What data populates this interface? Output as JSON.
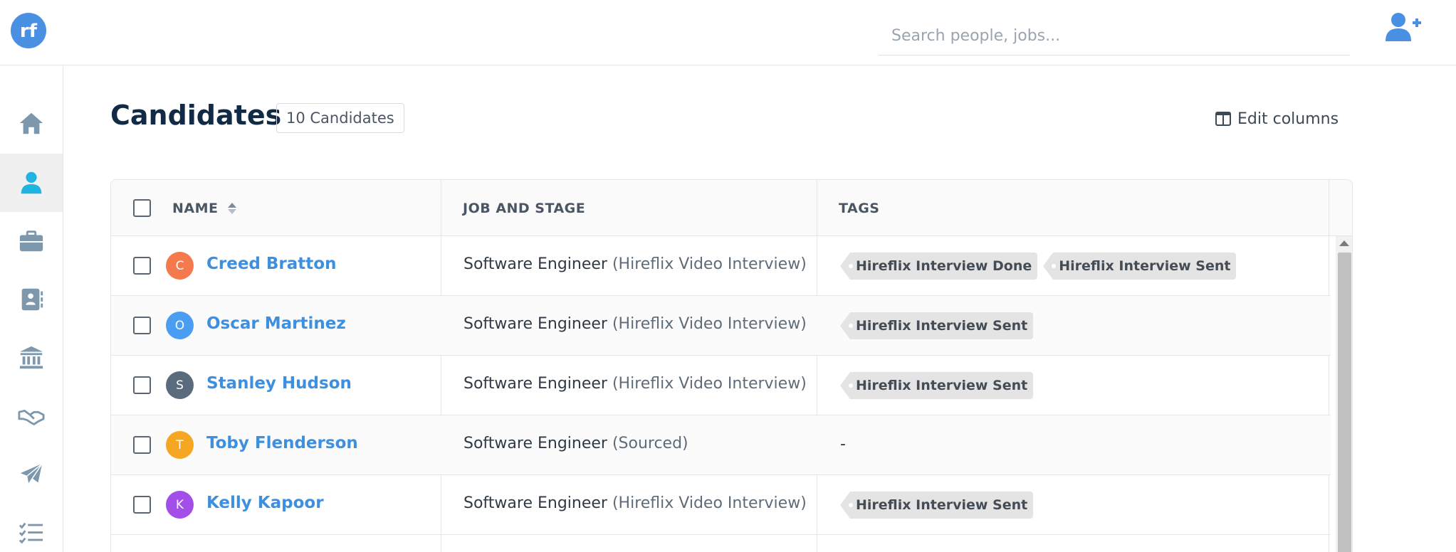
{
  "header": {
    "logo_text": "rf",
    "search_placeholder": "Search people, jobs..."
  },
  "sidebar": {
    "items": [
      {
        "name": "home-icon",
        "active": false
      },
      {
        "name": "person-icon",
        "active": true
      },
      {
        "name": "briefcase-icon",
        "active": false
      },
      {
        "name": "contact-book-icon",
        "active": false
      },
      {
        "name": "bank-icon",
        "active": false
      },
      {
        "name": "handshake-icon",
        "active": false
      },
      {
        "name": "paper-plane-icon",
        "active": false
      },
      {
        "name": "task-list-icon",
        "active": false
      }
    ]
  },
  "page": {
    "title": "Candidates",
    "count_label": "10 Candidates",
    "edit_columns_label": "Edit columns"
  },
  "table": {
    "columns": [
      "NAME",
      "JOB AND STAGE",
      "TAGS"
    ],
    "rows": [
      {
        "initial": "C",
        "name": "Creed Bratton",
        "job": "Software Engineer",
        "stage": "(Hireflix Video Interview)",
        "tags": [
          "Hireflix Interview Done",
          "Hireflix Interview Sent"
        ],
        "avatar_color": "#f47a4e"
      },
      {
        "initial": "O",
        "name": "Oscar Martinez",
        "job": "Software Engineer",
        "stage": "(Hireflix Video Interview)",
        "tags": [
          "Hireflix Interview Sent"
        ],
        "avatar_color": "#4a9df0"
      },
      {
        "initial": "S",
        "name": "Stanley Hudson",
        "job": "Software Engineer",
        "stage": "(Hireflix Video Interview)",
        "tags": [
          "Hireflix Interview Sent"
        ],
        "avatar_color": "#5b6b7e"
      },
      {
        "initial": "T",
        "name": "Toby Flenderson",
        "job": "Software Engineer",
        "stage": "(Sourced)",
        "tags": [],
        "empty_tags": "-",
        "avatar_color": "#f5a623"
      },
      {
        "initial": "K",
        "name": "Kelly Kapoor",
        "job": "Software Engineer",
        "stage": "(Hireflix Video Interview)",
        "tags": [
          "Hireflix Interview Sent"
        ],
        "avatar_color": "#a34ee8"
      }
    ]
  },
  "colors": {
    "brand": "#4a90e2",
    "link": "#3d8fe0",
    "sidebar_icon": "#7d98ac",
    "sidebar_active_icon": "#1fb5e0"
  }
}
